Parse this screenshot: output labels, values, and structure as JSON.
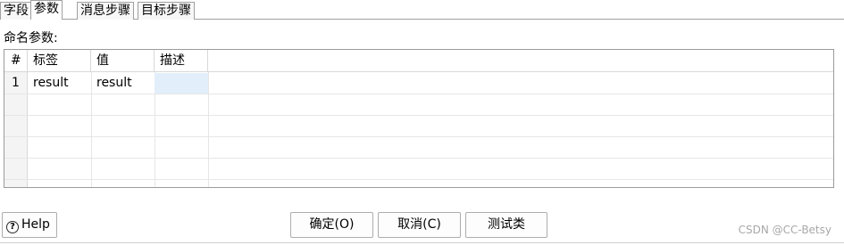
{
  "tabs": [
    {
      "label": "字段",
      "active": false
    },
    {
      "label": "参数",
      "active": true
    },
    {
      "label": "消息步骤",
      "active": false
    },
    {
      "label": "目标步骤",
      "active": false
    }
  ],
  "params_section": {
    "label": "命名参数:"
  },
  "table": {
    "columns": [
      "#",
      "标签",
      "值",
      "描述"
    ],
    "rows": [
      {
        "num": "1",
        "label": "result",
        "value": "result",
        "desc": ""
      }
    ]
  },
  "buttons": {
    "help": "Help",
    "ok": "确定(O)",
    "cancel": "取消(C)",
    "test": "测试类"
  },
  "watermark": "CSDN @CC-Betsy"
}
